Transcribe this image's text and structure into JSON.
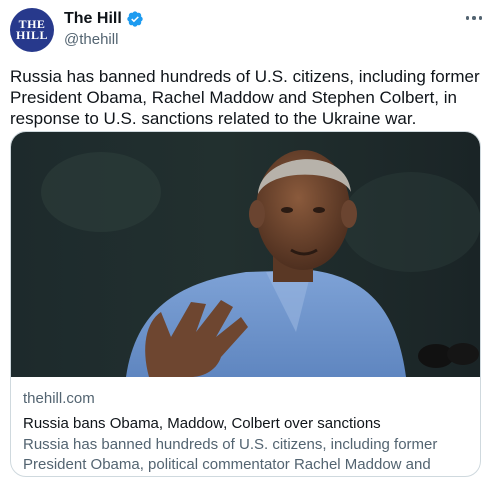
{
  "author": {
    "name": "The Hill",
    "handle": "@thehill",
    "avatar_text": [
      "THE",
      "HILL"
    ],
    "avatar_color": "#27398c",
    "verified": true,
    "verified_color": "#1d9bf0"
  },
  "tweet": {
    "text": "Russia has banned hundreds of U.S. citizens, including former President Obama, Rachel Maddow and Stephen Colbert, in response to U.S. sanctions related to the Ukraine war."
  },
  "card": {
    "image_icon": "photo-of-speaker",
    "domain": "thehill.com",
    "title": "Russia bans Obama, Maddow, Colbert over sanctions",
    "description": "Russia has banned hundreds of U.S. citizens, including former President Obama, political commentator Rachel Maddow and late-..."
  },
  "icons": {
    "more": "more-options-icon",
    "verified": "verified-badge-icon"
  }
}
